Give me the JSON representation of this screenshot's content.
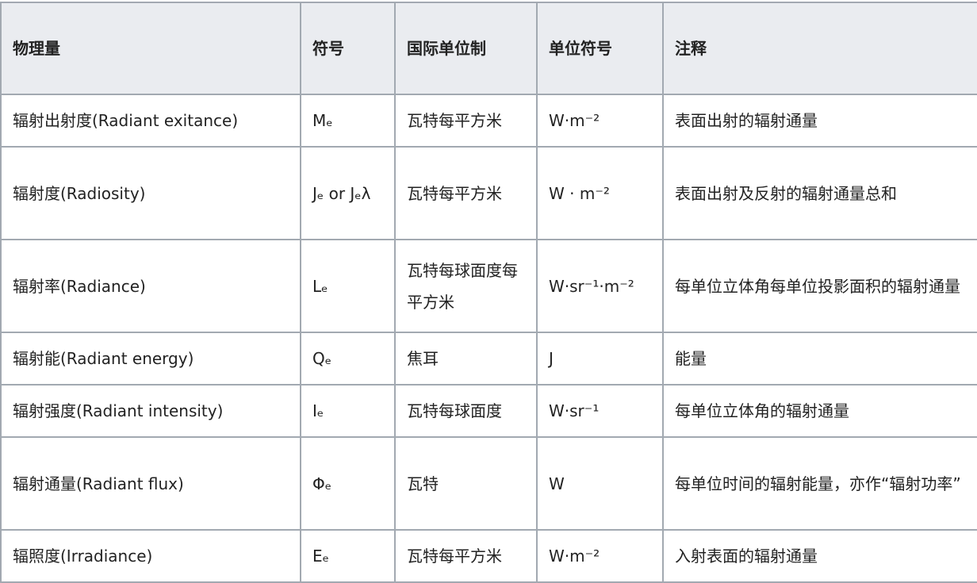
{
  "table": {
    "headers": {
      "quantity": "物理量",
      "symbol": "符号",
      "si_unit": "国际单位制",
      "unit_symbol": "单位符号",
      "note": "注释"
    },
    "rows": [
      {
        "quantity": "辐射出射度(Radiant exitance)",
        "symbol": "Mₑ",
        "si_unit": "瓦特每平方米",
        "unit_symbol": "W·m⁻²",
        "note": "表面出射的辐射通量"
      },
      {
        "quantity": "辐射度(Radiosity)",
        "symbol": "Jₑ or Jₑλ",
        "si_unit": "瓦特每平方米",
        "unit_symbol": "W · m⁻²",
        "note": "表面出射及反射的辐射通量总和"
      },
      {
        "quantity": "辐射率(Radiance)",
        "symbol": "Lₑ",
        "si_unit": "瓦特每球面度每平方米",
        "unit_symbol": "W·sr⁻¹·m⁻²",
        "note": "每单位立体角每单位投影面积的辐射通量"
      },
      {
        "quantity": "辐射能(Radiant energy)",
        "symbol": "Qₑ",
        "si_unit": "焦耳",
        "unit_symbol": "J",
        "note": "能量"
      },
      {
        "quantity": "辐射强度(Radiant intensity)",
        "symbol": "Iₑ",
        "si_unit": "瓦特每球面度",
        "unit_symbol": "W·sr⁻¹",
        "note": "每单位立体角的辐射通量"
      },
      {
        "quantity": "辐射通量(Radiant flux)",
        "symbol": "Φₑ",
        "si_unit": "瓦特",
        "unit_symbol": "W",
        "note": "每单位时间的辐射能量，亦作“辐射功率”"
      },
      {
        "quantity": "辐照度(Irradiance)",
        "symbol": "Eₑ",
        "si_unit": "瓦特每平方米",
        "unit_symbol": "W·m⁻²",
        "note": "入射表面的辐射通量"
      }
    ]
  }
}
